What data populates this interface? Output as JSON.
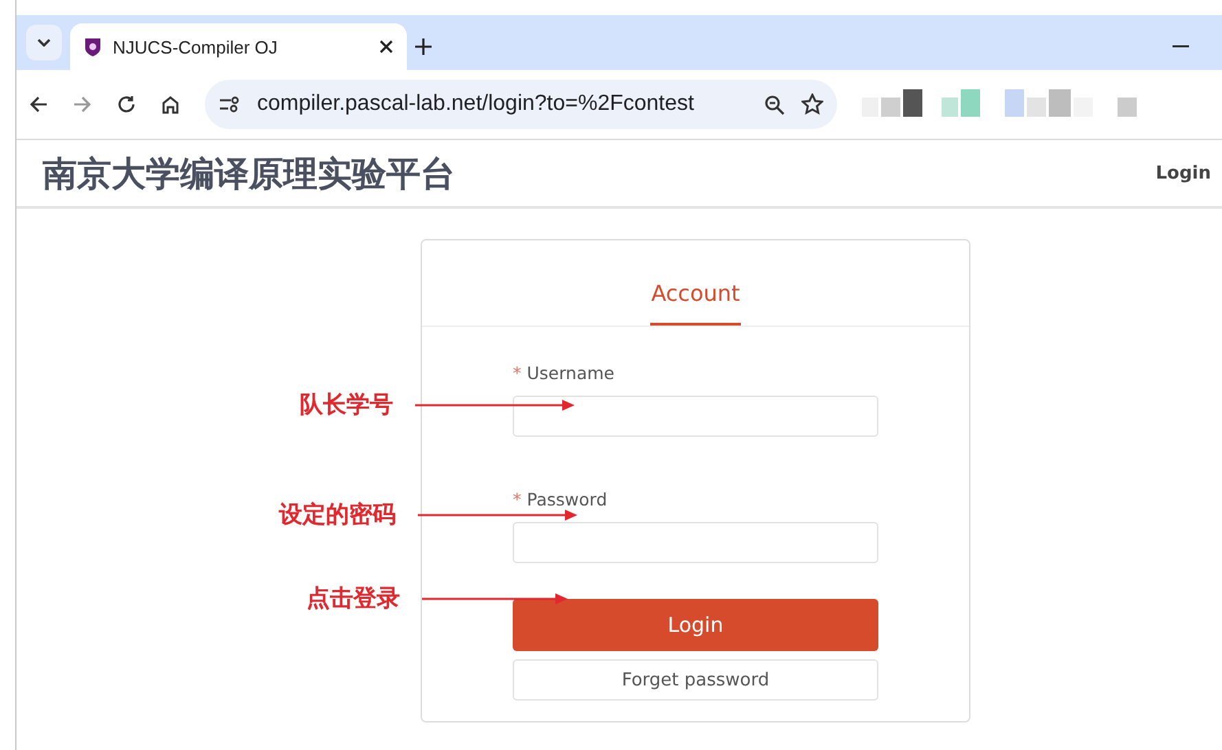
{
  "browser": {
    "tabs": [
      {
        "title": "NJUCS-Compiler OJ",
        "selected": true
      }
    ],
    "address": "compiler.pascal-lab.net/login?to=%2Fcontest"
  },
  "header": {
    "title": "南京大学编译原理实验平台",
    "login_link": "Login"
  },
  "login_card": {
    "tabs": [
      {
        "label": "Account",
        "selected": true
      }
    ],
    "fields": [
      {
        "label": "Username",
        "required_mark": "*"
      },
      {
        "label": "Password",
        "required_mark": "*"
      }
    ],
    "submit_button": "Login",
    "forget_button": "Forget password"
  },
  "annotations": [
    {
      "text": "队长学号"
    },
    {
      "text": "设定的密码"
    },
    {
      "text": "点击登录"
    }
  ]
}
